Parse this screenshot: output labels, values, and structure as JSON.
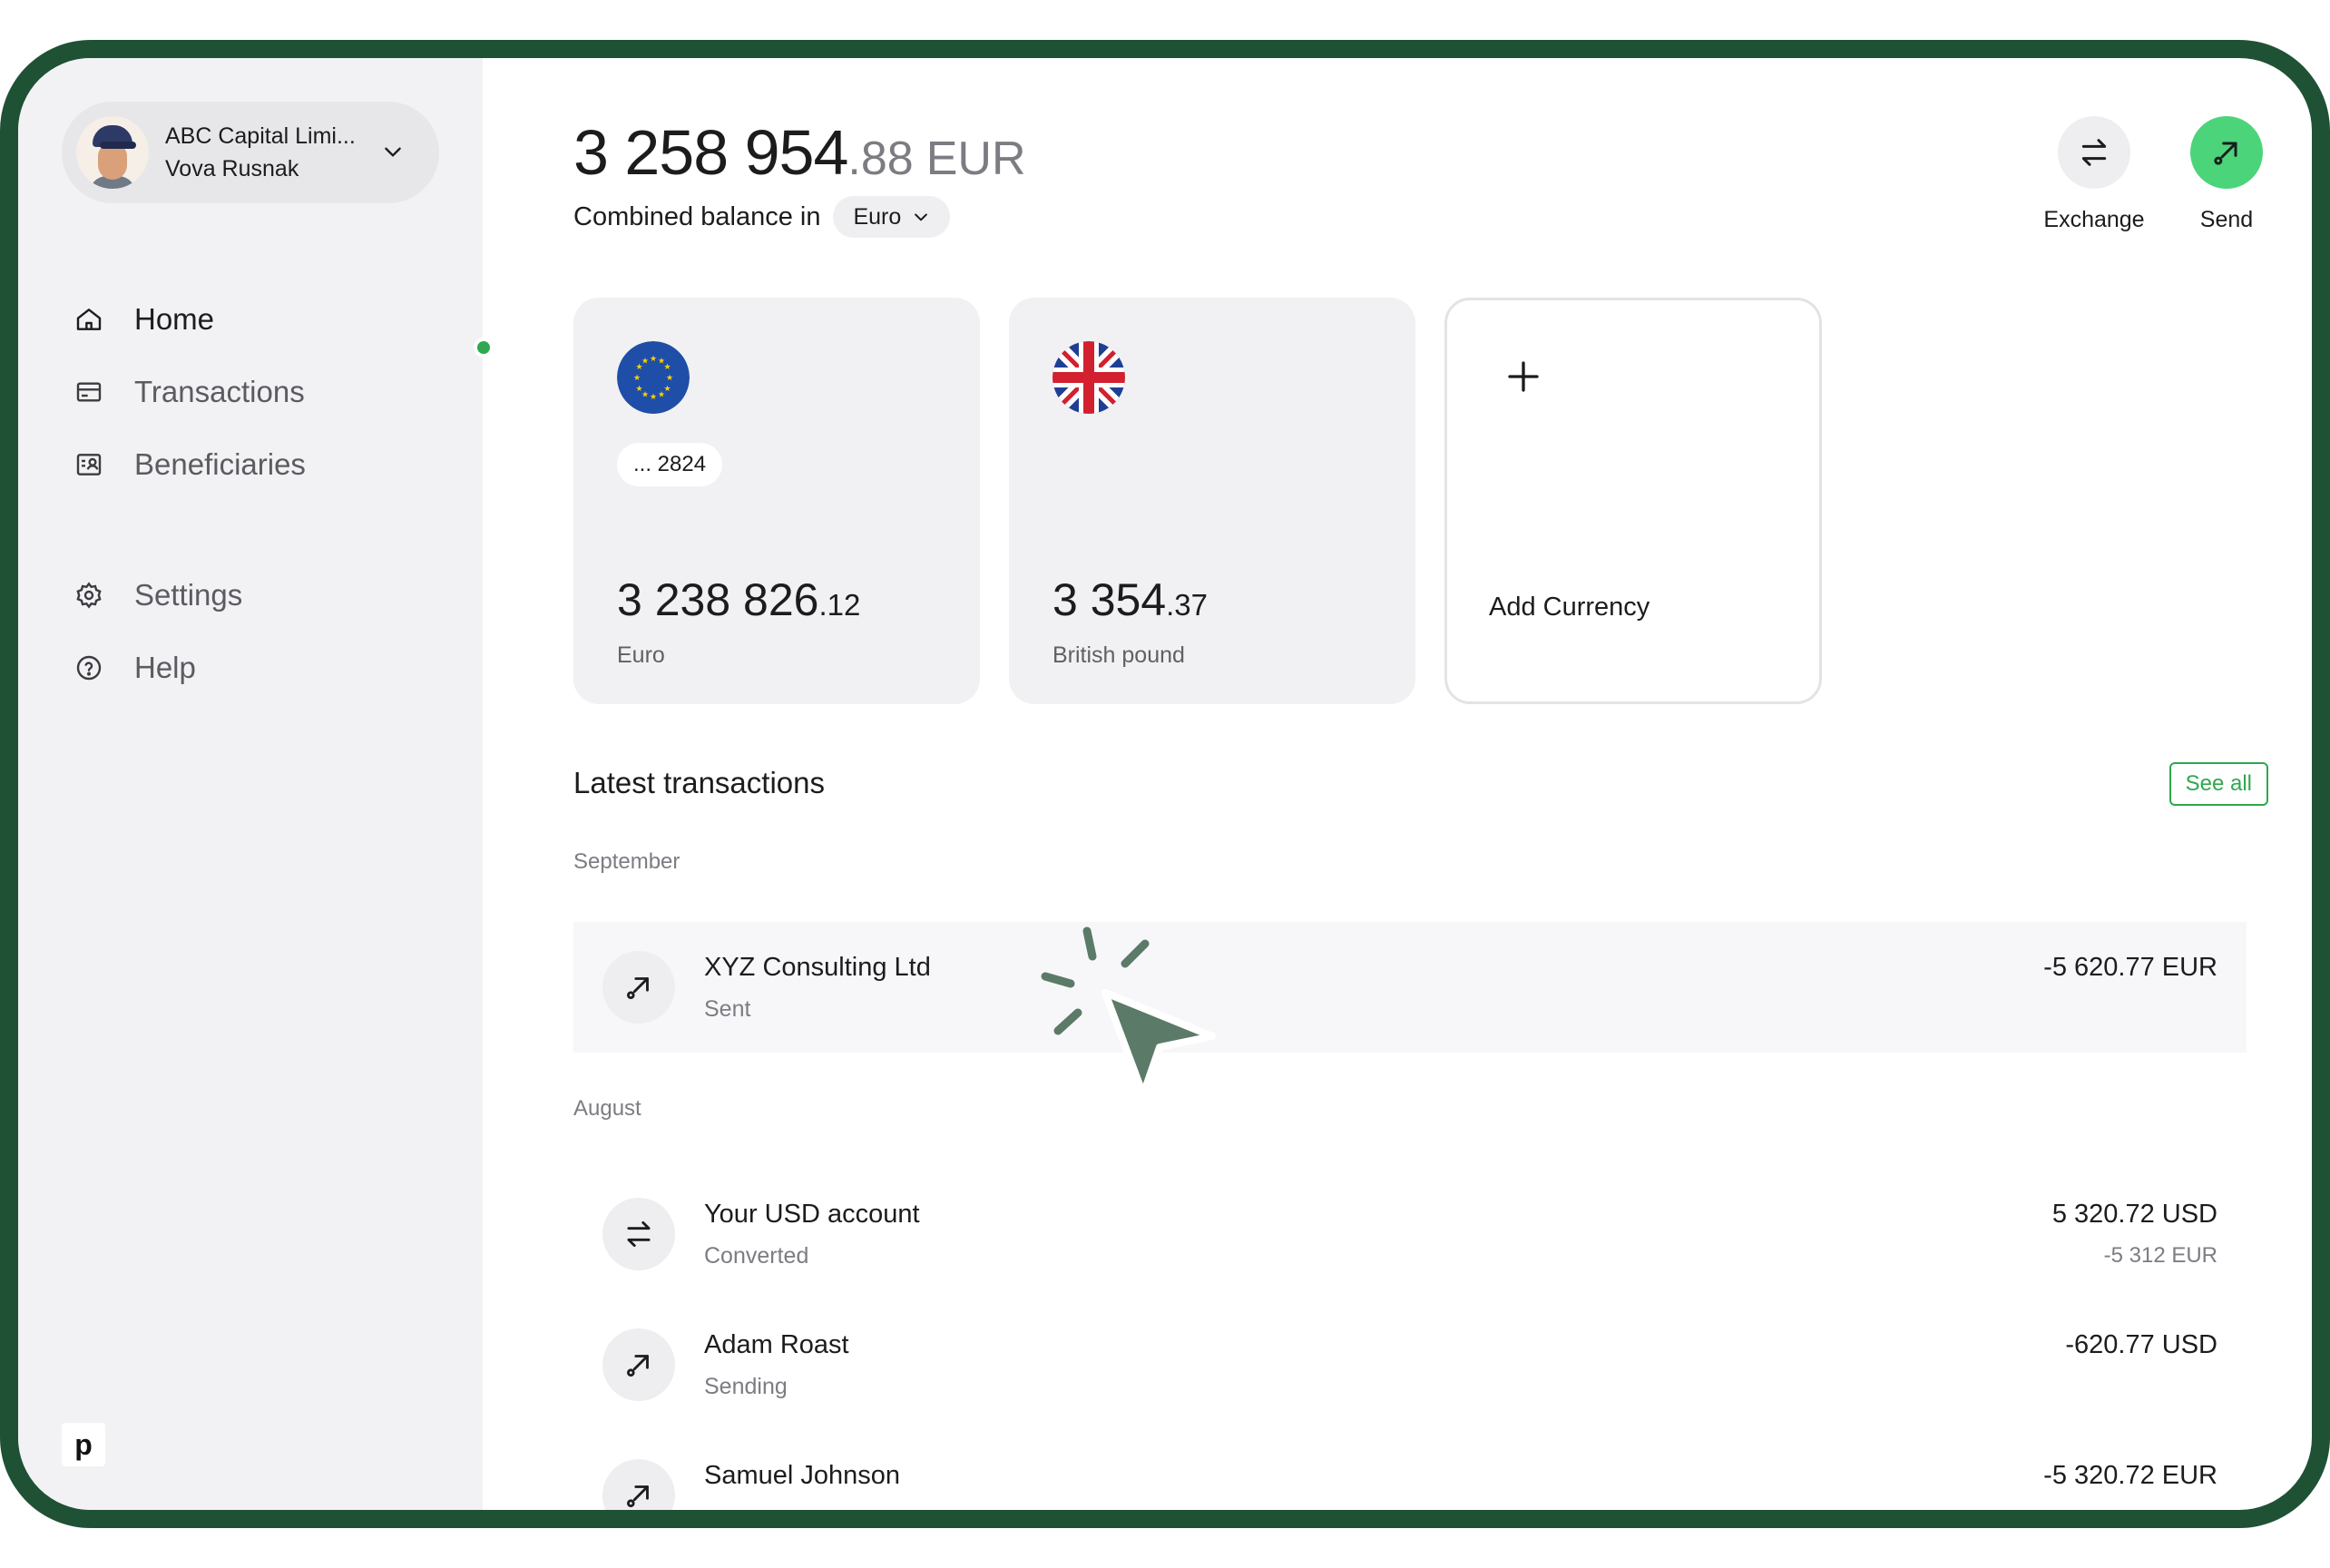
{
  "account": {
    "company": "ABC Capital Limi...",
    "user": "Vova Rusnak"
  },
  "nav": {
    "home": "Home",
    "transactions": "Transactions",
    "beneficiaries": "Beneficiaries",
    "settings": "Settings",
    "help": "Help"
  },
  "brand": {
    "logo_letter": "p"
  },
  "balance": {
    "integer": "3 258 954",
    "decimal": ".88",
    "currency": "EUR",
    "combined_label": "Combined balance in",
    "selected_currency": "Euro"
  },
  "actions": {
    "exchange": "Exchange",
    "send": "Send"
  },
  "cards": [
    {
      "account_suffix": "... 2824",
      "integer": "3 238 826",
      "decimal": ".12",
      "name": "Euro"
    },
    {
      "integer": "3 354",
      "decimal": ".37",
      "name": "British pound"
    }
  ],
  "add_card": {
    "label": "Add Currency"
  },
  "transactions": {
    "title": "Latest transactions",
    "see_all": "See all",
    "groups": [
      {
        "month": "September",
        "items": [
          {
            "name": "XYZ Consulting Ltd",
            "status": "Sent",
            "amount": "-5 620.77 EUR",
            "icon": "send-arrow-icon"
          }
        ]
      },
      {
        "month": "August",
        "items": [
          {
            "name": "Your USD account",
            "status": "Converted",
            "amount": "5 320.72 USD",
            "sub_amount": "-5 312 EUR",
            "icon": "exchange-icon"
          },
          {
            "name": "Adam Roast",
            "status": "Sending",
            "amount": "-620.77 USD",
            "icon": "send-arrow-icon"
          },
          {
            "name": "Samuel Johnson",
            "status": "",
            "amount": "-5 320.72 EUR",
            "icon": "send-arrow-icon"
          }
        ]
      }
    ]
  },
  "colors": {
    "frame": "#1f5135",
    "accent_green": "#2fa84f",
    "send_button": "#4cd47a",
    "cursor": "#5b7a68"
  }
}
